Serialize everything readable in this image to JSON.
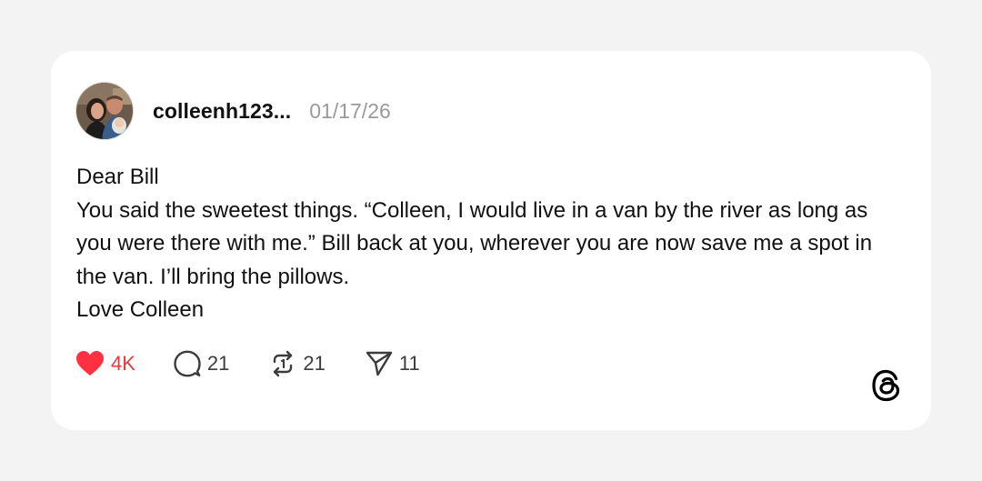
{
  "post": {
    "username": "colleenh123...",
    "date": "01/17/26",
    "avatar": "avatar-photo",
    "body_lines": [
      "Dear Bill",
      "You said the sweetest things. “Colleen, I would live in a van by the river as long as you were there with me.” Bill back at you, wherever you are now save me a spot in the van. I’ll bring the pillows.",
      "Love Colleen"
    ]
  },
  "actions": {
    "likes": "4K",
    "replies": "21",
    "reposts": "21",
    "shares": "11"
  },
  "icons": {
    "like": "heart-icon",
    "reply": "comment-icon",
    "repost": "repost-icon",
    "share": "send-icon",
    "brand": "threads-logo"
  },
  "colors": {
    "like_active": "#e8393f",
    "card_bg": "#ffffff",
    "page_bg": "#f3f3f3"
  }
}
